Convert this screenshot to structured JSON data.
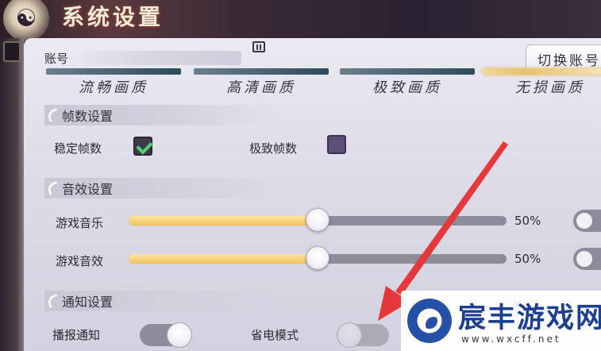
{
  "header": {
    "title": "系统设置",
    "emblem_glyph": "☯"
  },
  "account": {
    "label": "账号",
    "switch_label": "切换账号"
  },
  "quality": {
    "selected": "无损画质",
    "options": [
      "流畅画质",
      "高清画质",
      "极致画质",
      "无损画质"
    ]
  },
  "frames": {
    "section_title": "帧数设置",
    "stable_label": "稳定帧数",
    "stable_checked": true,
    "extreme_label": "极致帧数",
    "extreme_checked": false
  },
  "audio": {
    "section_title": "音效设置",
    "music_label": "游戏音乐",
    "music_percent": "50%",
    "music_value": 0.5,
    "sfx_label": "游戏音效",
    "sfx_percent": "50%",
    "sfx_value": 0.5
  },
  "notify": {
    "section_title": "通知设置",
    "broadcast_label": "播报通知",
    "broadcast_on": true,
    "power_label": "省电模式",
    "power_on": false
  },
  "watermark": {
    "name": "宸丰游戏网",
    "url": "www.wxcff.net"
  },
  "colors": {
    "accent": "#f2c15b",
    "check": "#55d06a",
    "arrow": "#e5383b",
    "panel": "#e3e1ec"
  }
}
